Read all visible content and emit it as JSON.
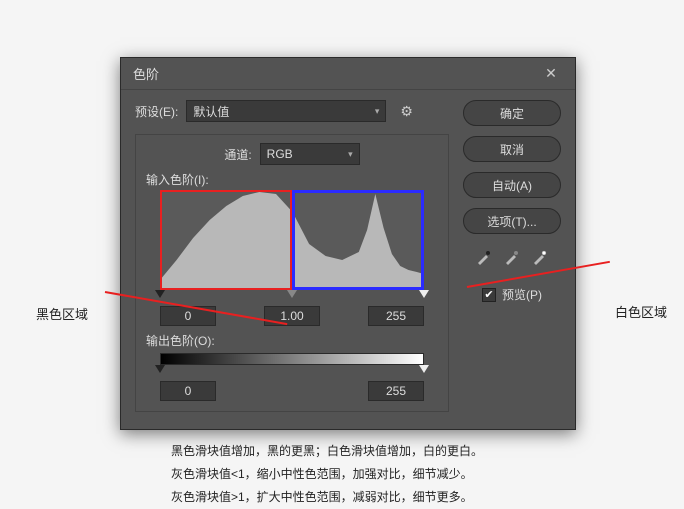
{
  "dialog": {
    "title": "色阶",
    "preset": {
      "label": "预设(E):",
      "value": "默认值"
    },
    "channel": {
      "label": "通道:",
      "value": "RGB"
    },
    "input_levels": {
      "label": "输入色阶(I):",
      "shadow": "0",
      "mid": "1.00",
      "highlight": "255"
    },
    "output_levels": {
      "label": "输出色阶(O):",
      "shadow": "0",
      "highlight": "255"
    },
    "buttons": {
      "ok": "确定",
      "cancel": "取消",
      "auto": "自动(A)",
      "options": "选项(T)..."
    },
    "preview": {
      "label": "预览(P)",
      "checked": "✔"
    }
  },
  "annotations": {
    "black_region": "黑色区域",
    "white_region": "白色区域",
    "box_red": "red-annotation-box",
    "box_blue": "blue-annotation-box"
  },
  "notes": {
    "line1": "黑色滑块值增加，黑的更黑；白色滑块值增加，白的更白。",
    "line2": "灰色滑块值<1，缩小中性色范围，加强对比，细节减少。",
    "line3": "灰色滑块值>1，扩大中性色范围，减弱对比，细节更多。"
  },
  "chart_data": {
    "type": "area",
    "title": "",
    "xlabel": "",
    "ylabel": "",
    "xlim": [
      0,
      255
    ],
    "ylim": [
      0,
      100
    ],
    "series": [
      {
        "name": "histogram",
        "x": [
          0,
          16,
          32,
          48,
          64,
          80,
          96,
          112,
          128,
          144,
          160,
          176,
          192,
          200,
          208,
          216,
          224,
          232,
          240,
          248,
          255
        ],
        "values": [
          10,
          30,
          52,
          70,
          84,
          94,
          98,
          96,
          78,
          46,
          34,
          30,
          38,
          60,
          96,
          62,
          36,
          24,
          20,
          18,
          16
        ]
      }
    ]
  }
}
